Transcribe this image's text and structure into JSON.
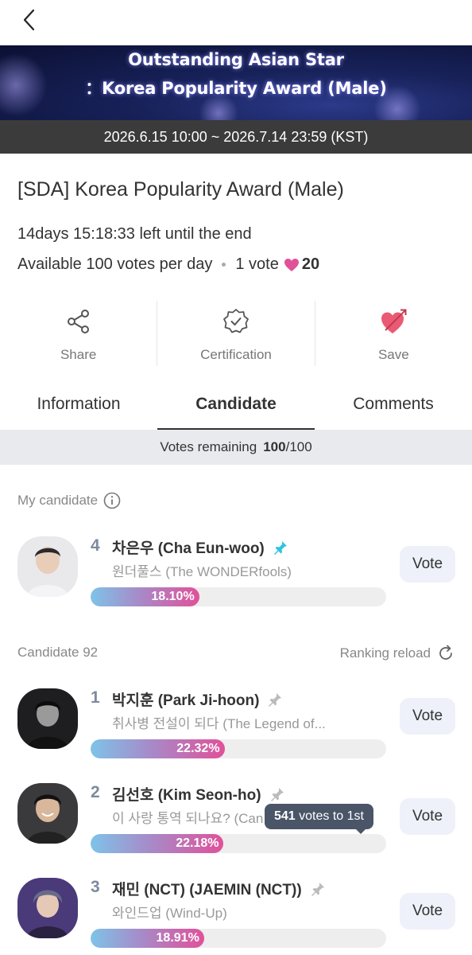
{
  "banner": {
    "line1": "Outstanding Asian Star",
    "line2": "：Korea Popularity Award (Male)"
  },
  "period": "2026.6.15 10:00 ~ 2026.7.14 23:59 (KST)",
  "award_title": "[SDA] Korea Popularity Award (Male)",
  "time_left": "14days 15:18:33 left until the end",
  "votes_info": {
    "available": "Available 100 votes per day",
    "per_vote": "1 vote",
    "hearts": "20"
  },
  "actions": [
    {
      "label": "Share",
      "icon": "share-icon"
    },
    {
      "label": "Certification",
      "icon": "certification-badge-icon"
    },
    {
      "label": "Save",
      "icon": "heart-arrow-icon"
    }
  ],
  "tabs": [
    {
      "label": "Information",
      "active": false
    },
    {
      "label": "Candidate",
      "active": true
    },
    {
      "label": "Comments",
      "active": false
    }
  ],
  "remaining": {
    "label": "Votes remaining",
    "current": "100",
    "total": "/100"
  },
  "my_candidate_label": "My candidate",
  "candidate_count_label": "Candidate 92",
  "reload_label": "Ranking reload",
  "vote_label": "Vote",
  "my_candidate": {
    "rank": "4",
    "name": "차은우 (Cha Eun-woo)",
    "subtitle": "원더풀스 (The WONDERfools)",
    "percent": 18.1,
    "percent_label": "18.10%",
    "pinned": true
  },
  "candidates": [
    {
      "rank": "1",
      "name": "박지훈 (Park Ji-hoon)",
      "subtitle": "취사병 전설이 되다 (The Legend of...",
      "percent": 22.32,
      "percent_label": "22.32%",
      "pinned": false
    },
    {
      "rank": "2",
      "name": "김선호 (Kim Seon-ho)",
      "subtitle": "이 사랑 통역 되나요? (Can",
      "percent": 22.18,
      "percent_label": "22.18%",
      "pinned": false
    },
    {
      "rank": "3",
      "name": "재민 (NCT) (JAEMIN (NCT))",
      "subtitle": "와인드업 (Wind-Up)",
      "percent": 18.91,
      "percent_label": "18.91%",
      "pinned": false
    }
  ],
  "tooltip": {
    "count": "541",
    "text": "votes to 1st"
  },
  "colors": {
    "accent_pink": "#e0519a",
    "accent_blue": "#7ec3e8",
    "pin_active": "#2ec4e0",
    "pin_inactive": "#bbbbbb"
  }
}
